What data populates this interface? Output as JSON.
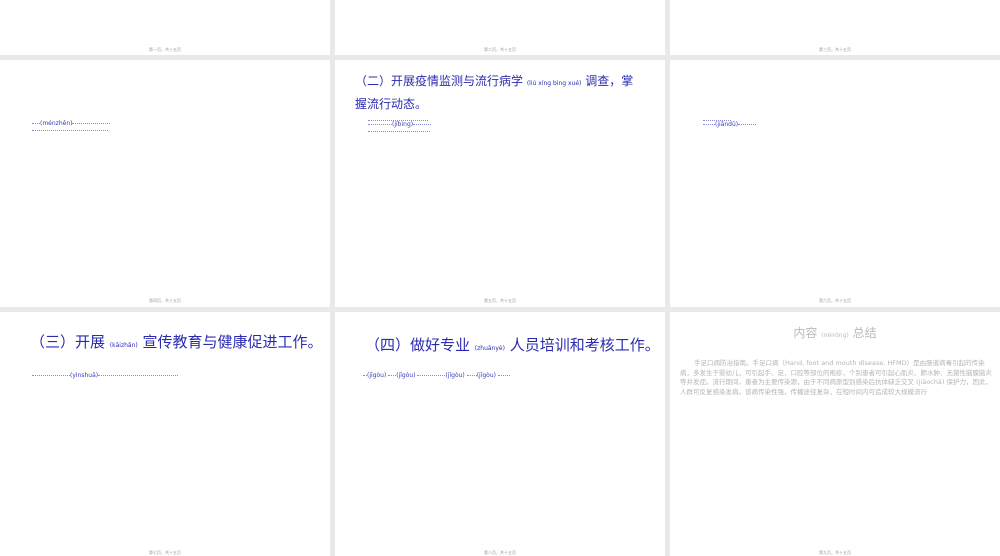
{
  "slides": [
    {
      "footer": "第一页，共十五页"
    },
    {
      "footer": "第二页，共十五页"
    },
    {
      "footer": "第三页，共十五页"
    },
    {
      "footer": "第四页，共十五页",
      "pinyin": "(ménzhěn)"
    },
    {
      "footer": "第五页，共十五页",
      "title": "（二）开展疫情监测与流行病学",
      "title_pinyin": "(liú xíng bìng xué)",
      "title_end": "调查，掌握流行动态。",
      "pinyin": "(jíbìng)"
    },
    {
      "footer": "第六页，共十五页",
      "pinyin": "(jiāndū)"
    },
    {
      "footer": "第七页，共十五页",
      "title_a": "（三）开展",
      "title_pinyin": "(kāizhǎn)",
      "title_b": "宣传教育与健康促进工作。",
      "pinyin": "(yìnshuā)"
    },
    {
      "footer": "第八页，共十五页",
      "title_a": "（四）做好专业",
      "title_pinyin": "(zhuānyè)",
      "title_b": "人员培训和考核工作。",
      "pinyins": [
        "(jīgòu)",
        "(jīgòu)",
        "(jīgòu)",
        "(jīgòu)"
      ]
    },
    {
      "footer": "第九页，共十五页",
      "title_a": "内容",
      "title_pinyin": "(nèiróng)",
      "title_b": "总结",
      "body": "手足口病防治指南。手足口病（Hand, foot and mouth disease, HFMD）是由肠道病毒引起的传染病，多发生于婴幼儿，可引起手、足、口腔等部位的疱疹，个别患者可引起心肌炎、肺水肿、无菌性脑膜脑炎等并发症。流行期间，患者为主要传染源，由于不同病原型别感染后抗体缺乏交叉 (jiāochā) 保护力，因此，人群可反复感染发病。该病传染性强，传播途径复杂，在短时间内可造成较大规模流行"
    }
  ]
}
